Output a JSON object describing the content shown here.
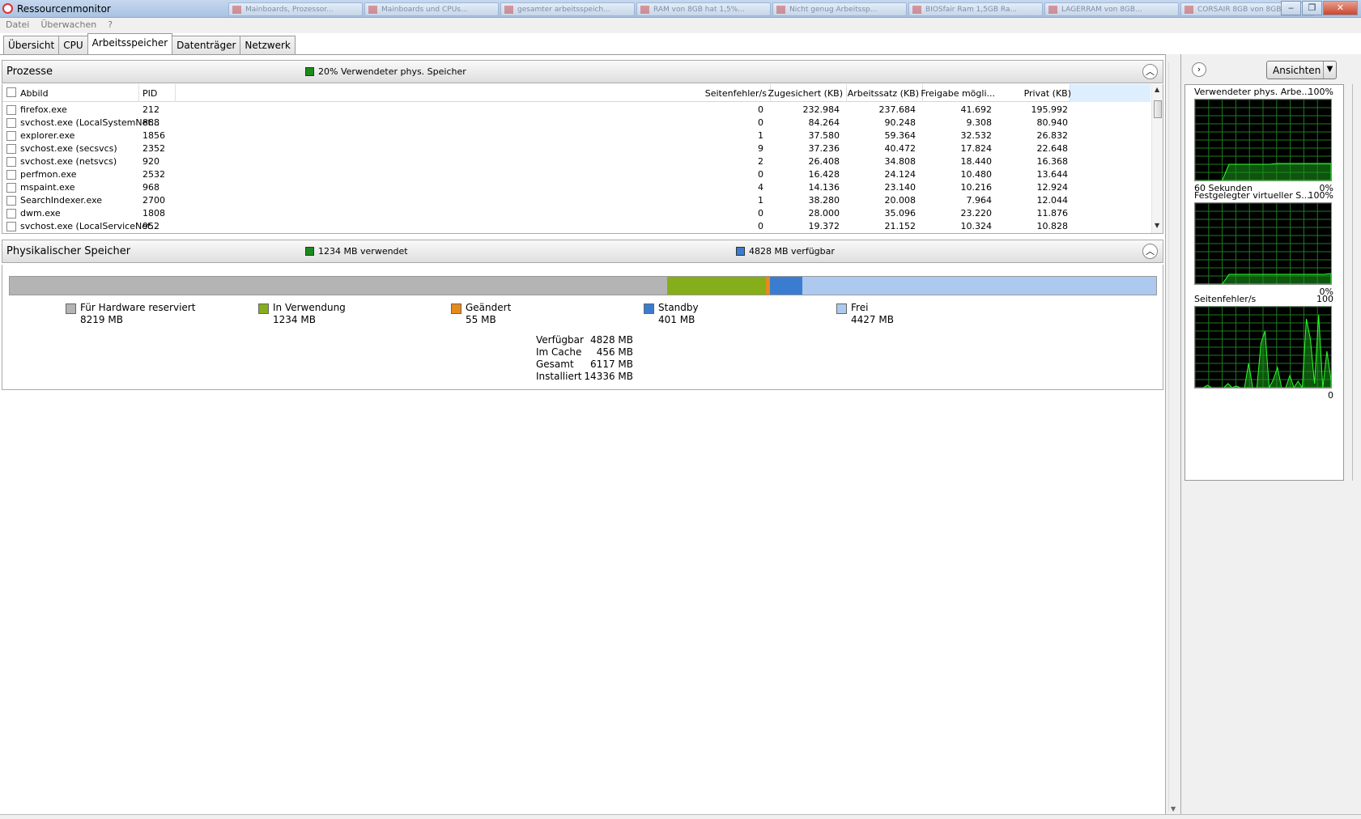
{
  "window": {
    "title": "Ressourcenmonitor",
    "taskbar_items": [
      "Mainboards, Prozessor...",
      "Mainboards und CPUs...",
      "gesamter arbeitsspeich...",
      "RAM von 8GB hat 1,5%...",
      "Nicht genug Arbeitssp...",
      "BIOSfair Ram 1,5GB Ra...",
      "LAGERRAM von 8GB...",
      "CORSAIR 8GB von 8GB..."
    ],
    "minimize": "‒",
    "maximize": "❐",
    "close": "✕"
  },
  "menu": {
    "file": "Datei",
    "monitor": "Überwachen",
    "help": "?"
  },
  "tabs": [
    "Übersicht",
    "CPU",
    "Arbeitsspeicher",
    "Datenträger",
    "Netzwerk"
  ],
  "active_tab": "Arbeitsspeicher",
  "processes": {
    "title": "Prozesse",
    "indicator": "20% Verwendeter phys. Speicher",
    "indicator_color": "#1a8a1a",
    "columns": [
      "Abbild",
      "PID",
      "Seitenfehler/s",
      "Zugesichert (KB)",
      "Arbeitssatz (KB)",
      "Freigabe mögli...",
      "Privat (KB)"
    ],
    "rows": [
      [
        "firefox.exe",
        "212",
        "0",
        "232.984",
        "237.684",
        "41.692",
        "195.992"
      ],
      [
        "svchost.exe (LocalSystemNet...",
        "888",
        "0",
        "84.264",
        "90.248",
        "9.308",
        "80.940"
      ],
      [
        "explorer.exe",
        "1856",
        "1",
        "37.580",
        "59.364",
        "32.532",
        "26.832"
      ],
      [
        "svchost.exe (secsvcs)",
        "2352",
        "9",
        "37.236",
        "40.472",
        "17.824",
        "22.648"
      ],
      [
        "svchost.exe (netsvcs)",
        "920",
        "2",
        "26.408",
        "34.808",
        "18.440",
        "16.368"
      ],
      [
        "perfmon.exe",
        "2532",
        "0",
        "16.428",
        "24.124",
        "10.480",
        "13.644"
      ],
      [
        "mspaint.exe",
        "968",
        "4",
        "14.136",
        "23.140",
        "10.216",
        "12.924"
      ],
      [
        "SearchIndexer.exe",
        "2700",
        "1",
        "38.280",
        "20.008",
        "7.964",
        "12.044"
      ],
      [
        "dwm.exe",
        "1808",
        "0",
        "28.000",
        "35.096",
        "23.220",
        "11.876"
      ],
      [
        "svchost.exe (LocalServiceNet...",
        "952",
        "0",
        "19.372",
        "21.152",
        "10.324",
        "10.828"
      ]
    ]
  },
  "physical": {
    "title": "Physikalischer Speicher",
    "used_indicator": "1234 MB verwendet",
    "used_color": "#1a8a1a",
    "avail_indicator": "4828 MB verfügbar",
    "avail_color": "#3a7dd0",
    "segments": [
      {
        "label": "Für Hardware reserviert",
        "value": "8219 MB",
        "mb": 8219,
        "color": "#b4b4b4"
      },
      {
        "label": "In Verwendung",
        "value": "1234 MB",
        "mb": 1234,
        "color": "#86ad1a"
      },
      {
        "label": "Geändert",
        "value": "55 MB",
        "mb": 55,
        "color": "#e68a1a"
      },
      {
        "label": "Standby",
        "value": "401 MB",
        "mb": 401,
        "color": "#3a7dd0"
      },
      {
        "label": "Frei",
        "value": "4427 MB",
        "mb": 4427,
        "color": "#adc9ef"
      }
    ],
    "stats": [
      {
        "key": "Verfügbar",
        "value": "4828 MB"
      },
      {
        "key": "Im Cache",
        "value": "456 MB"
      },
      {
        "key": "Gesamt",
        "value": "6117 MB"
      },
      {
        "key": "Installiert",
        "value": "14336 MB"
      }
    ]
  },
  "side": {
    "views_button": "Ansichten",
    "graphs": [
      {
        "title": "Verwendeter phys. Arbe...",
        "max": "100%",
        "footer_left": "60 Sekunden",
        "footer_right": "0%",
        "level": [
          0,
          0,
          0,
          0,
          0,
          20,
          20,
          20,
          20,
          20,
          20,
          20,
          21,
          21,
          21,
          21,
          21,
          21,
          21,
          21,
          21
        ]
      },
      {
        "title": "Festgelegter virtueller S...",
        "max": "100%",
        "footer_left": "",
        "footer_right": "0%",
        "level": [
          0,
          0,
          0,
          0,
          0,
          12,
          12,
          12,
          12,
          12,
          12,
          12,
          12,
          12,
          12,
          12,
          12,
          12,
          12,
          12,
          13
        ]
      },
      {
        "title": "Seitenfehler/s",
        "max": "100",
        "footer_left": "",
        "footer_right": "0",
        "level": [
          0,
          0,
          0,
          3,
          0,
          0,
          0,
          0,
          5,
          0,
          2,
          0,
          0,
          30,
          0,
          0,
          55,
          70,
          0,
          10,
          25,
          0,
          0,
          15,
          0,
          8,
          0,
          85,
          60,
          5,
          90,
          0,
          45,
          10
        ]
      }
    ]
  }
}
